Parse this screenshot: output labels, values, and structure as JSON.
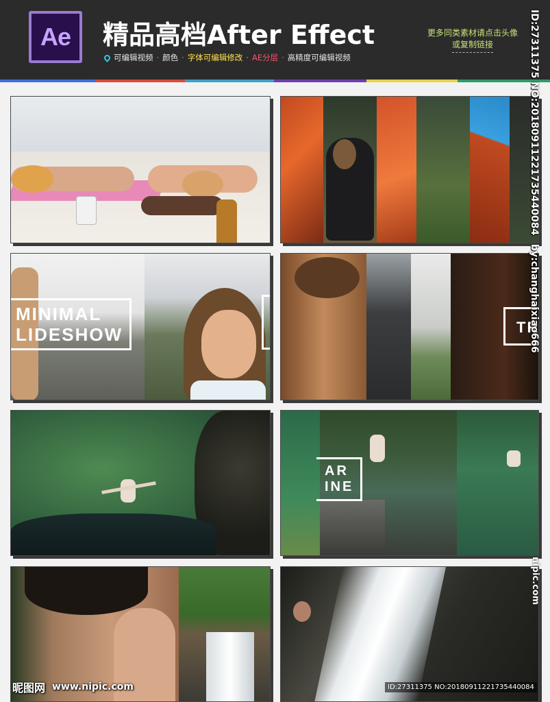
{
  "header": {
    "logo_text": "Ae",
    "title": "精品高档After Effect",
    "features": [
      {
        "text": "可编辑视频",
        "color": "#e6e6e6"
      },
      {
        "text": "颜色",
        "color": "#e6e6e6"
      },
      {
        "text": "字体可编辑修改",
        "color": "#ffe14a"
      },
      {
        "text": "AE分层",
        "color": "#ff4f6d"
      },
      {
        "text": "高精度可编辑视频",
        "color": "#e6e6e6"
      }
    ],
    "feature_separator": "·",
    "promo_line1": "更多同类素材请点击头像",
    "promo_line2": "或复制链接",
    "stripe_colors": [
      "#3f6fd8",
      "#d94a3b",
      "#3fa0c8",
      "#6b3fb0",
      "#e8d24a",
      "#2f9a6a"
    ]
  },
  "thumbnails": [
    {
      "id": "beach-sunbathers",
      "overlay": null
    },
    {
      "id": "redwood-bridge-girl",
      "overlay": null
    },
    {
      "id": "minimal-slideshow",
      "overlay": {
        "line1": "MINIMAL",
        "line2": "LIDESHOW"
      }
    },
    {
      "id": "car-selfie",
      "overlay": {
        "line1": "TR"
      }
    },
    {
      "id": "river-swimmer",
      "overlay": null
    },
    {
      "id": "river-jumper",
      "overlay": {
        "line1": "AR",
        "line2": "INE"
      }
    },
    {
      "id": "face-waterfall",
      "overlay": null
    },
    {
      "id": "waterfall-closeup",
      "overlay": null
    }
  ],
  "watermarks": {
    "side_id": "ID:27311375 NO:20180911221735440084",
    "side_author": "by:changhaixiao666",
    "side_site": "nipic.com",
    "site_name": "昵图网",
    "site_url": "www.nipic.com",
    "bottom_id": "ID:27311375 NO:20180911221735440084"
  },
  "colors": {
    "header_bg": "#2b2b2b",
    "ae_purple": "#9a7bd1",
    "promo_green": "#c6e27a"
  }
}
